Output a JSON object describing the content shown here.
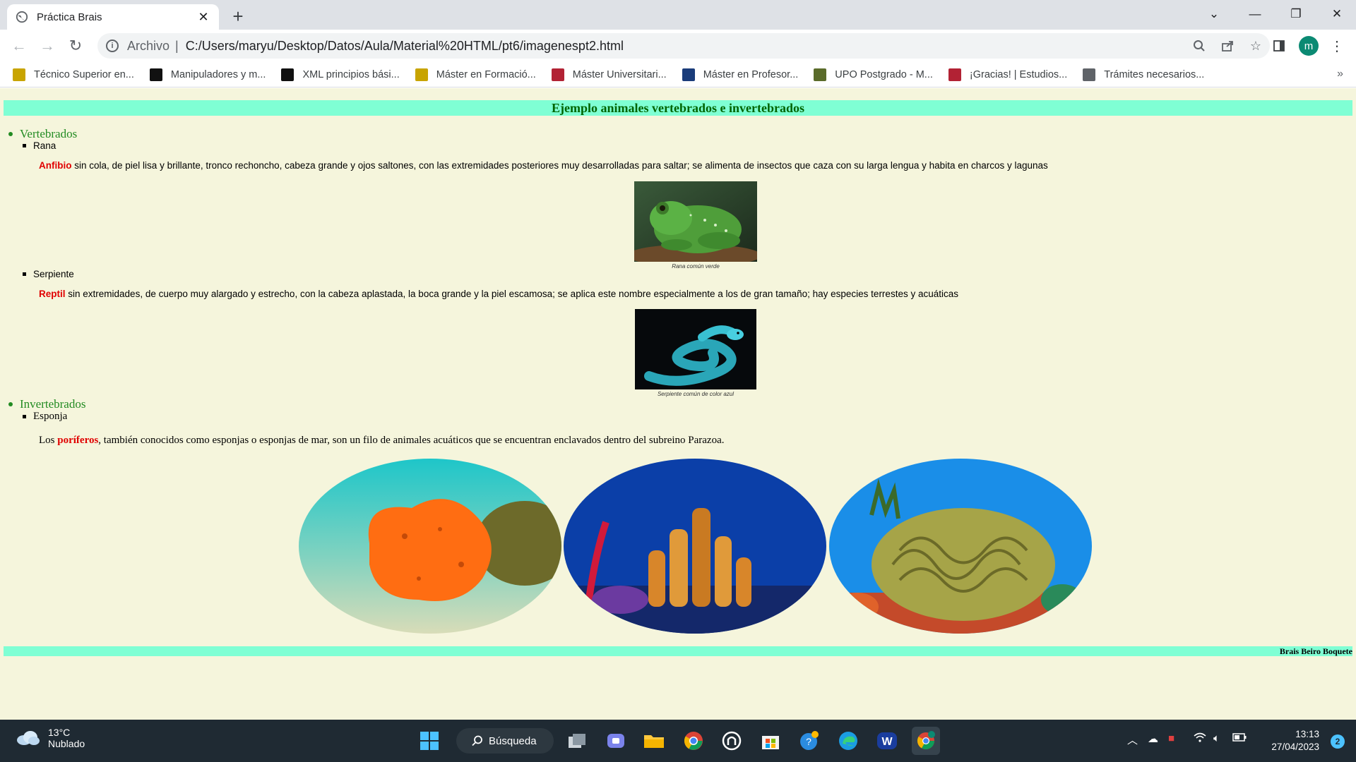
{
  "browser": {
    "tab_title": "Práctica Brais",
    "address_scheme": "Archivo",
    "address_url": "C:/Users/maryu/Desktop/Datos/Aula/Material%20HTML/pt6/imagenespt2.html",
    "bookmarks": [
      {
        "label": "Técnico Superior en...",
        "icon": "spain-crest-icon",
        "color": "#c8a400"
      },
      {
        "label": "Manipuladores y m...",
        "icon": "e-letter-icon",
        "color": "#111111"
      },
      {
        "label": "XML principios bási...",
        "icon": "symfony-icon",
        "color": "#111111"
      },
      {
        "label": "Máster en Formació...",
        "icon": "spain-crest-icon",
        "color": "#c8a400"
      },
      {
        "label": "Máster Universitari...",
        "icon": "university-icon",
        "color": "#b22234"
      },
      {
        "label": "Máster en Profesor...",
        "icon": "uax-icon",
        "color": "#1a3c7a"
      },
      {
        "label": "UPO Postgrado - M...",
        "icon": "upo-icon",
        "color": "#5a6b2a"
      },
      {
        "label": "¡Gracias! | Estudios...",
        "icon": "university-icon",
        "color": "#b22234"
      },
      {
        "label": "Trámites necesarios...",
        "icon": "globe-icon",
        "color": "#5f6368"
      }
    ],
    "bookmarks_more": "»",
    "profile_initial": "m"
  },
  "page": {
    "header": "Ejemplo animales vertebrados e invertebrados",
    "vertebrados": {
      "title": "Vertebrados",
      "rana": {
        "name": "Rana",
        "keyword": "Anfibio",
        "text": " sin cola, de piel lisa y brillante, tronco rechoncho, cabeza grande y ojos saltones, con las extremidades posteriores muy desarrolladas para saltar; se alimenta de insectos que caza con su larga lengua y habita en charcos y lagunas",
        "caption": "Rana común verde"
      },
      "serpiente": {
        "name": "Serpiente",
        "keyword": "Reptil",
        "text": " sin extremidades, de cuerpo muy alargado y estrecho, con la cabeza aplastada, la boca grande y la piel escamosa; se aplica este nombre especialmente a los de gran tamaño; hay especies terrestes y acuáticas",
        "caption": "Serpiente común de color azul"
      }
    },
    "invertebrados": {
      "title": "Invertebrados",
      "esponja": {
        "name": "Esponja",
        "prefix": "Los ",
        "keyword": "poríferos",
        "text": ", también conocidos como esponjas o esponjas de mar, son un filo de animales acuáticos que se encuentran enclavados dentro del subreino Parazoa."
      }
    },
    "footer": "Brais Beiro Boquete"
  },
  "taskbar": {
    "weather_temp": "13°C",
    "weather_desc": "Nublado",
    "search_label": "Búsqueda",
    "time": "13:13",
    "date": "27/04/2023",
    "notifications": "2"
  }
}
